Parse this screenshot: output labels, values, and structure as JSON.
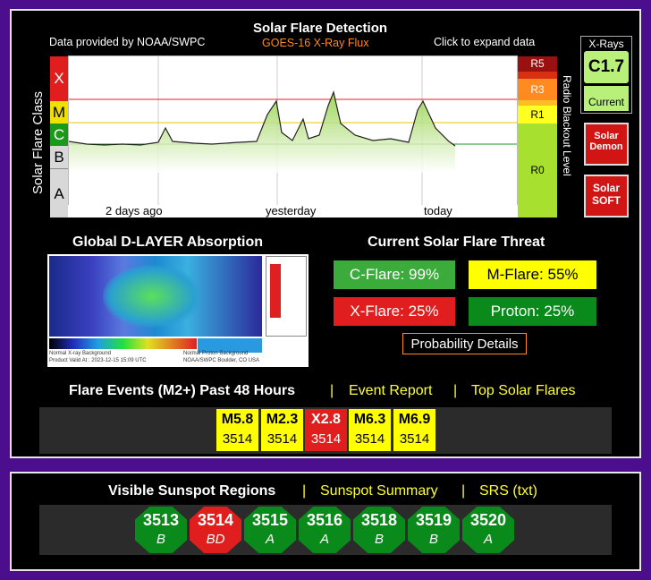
{
  "top": {
    "title": "Solar Flare Detection",
    "provider": "Data provided by NOAA/SWPC",
    "subtitle": "GOES-16 X-Ray Flux",
    "expand": "Click to expand data",
    "yaxis_label": "Solar Flare Class",
    "classes": [
      "X",
      "M",
      "C",
      "B",
      "A"
    ],
    "radio_label": "Radio Blackout Level",
    "radio_levels": [
      "R5",
      "R3",
      "R1",
      "R0"
    ],
    "x_ticks": [
      "2 days ago",
      "yesterday",
      "today"
    ]
  },
  "xray": {
    "label": "X-Rays",
    "value": "C1.7",
    "current": "Current"
  },
  "buttons": {
    "demon1": "Solar",
    "demon2": "Demon",
    "soft1": "Solar",
    "soft2": "SOFT"
  },
  "dlayer": {
    "title": "Global D-LAYER Absorption",
    "legend_left": "Normal X-ray Background",
    "legend_left2": "Product Valid At : 2023-12-15 15:09 UTC",
    "legend_right": "Normal Proton Background",
    "legend_right2": "NOAA/SWPC Boulder, CO USA"
  },
  "threat": {
    "title": "Current Solar Flare Threat",
    "c": "C-Flare: 99%",
    "m": "M-Flare: 55%",
    "x": "X-Flare: 25%",
    "p": "Proton: 25%",
    "details": "Probability Details"
  },
  "events": {
    "title": "Flare Events (M2+) Past 48 Hours",
    "sep": "|",
    "report": "Event Report",
    "top": "Top Solar Flares",
    "items": [
      {
        "cls": "M5.8",
        "region": "3514"
      },
      {
        "cls": "M2.3",
        "region": "3514"
      },
      {
        "cls": "X2.8",
        "region": "3514"
      },
      {
        "cls": "M6.3",
        "region": "3514"
      },
      {
        "cls": "M6.9",
        "region": "3514"
      }
    ]
  },
  "sunspots": {
    "title": "Visible Sunspot Regions",
    "sep": "|",
    "summary": "Sunspot Summary",
    "srs": "SRS (txt)",
    "items": [
      {
        "num": "3513",
        "mag": "B"
      },
      {
        "num": "3514",
        "mag": "BD"
      },
      {
        "num": "3515",
        "mag": "A"
      },
      {
        "num": "3516",
        "mag": "A"
      },
      {
        "num": "3518",
        "mag": "B"
      },
      {
        "num": "3519",
        "mag": "B"
      },
      {
        "num": "3520",
        "mag": "A"
      }
    ]
  },
  "colors": {
    "green": "#0a8a1a",
    "red": "#e01e1e",
    "yellow": "#ffff00",
    "orange": "#ff8a1f"
  }
}
